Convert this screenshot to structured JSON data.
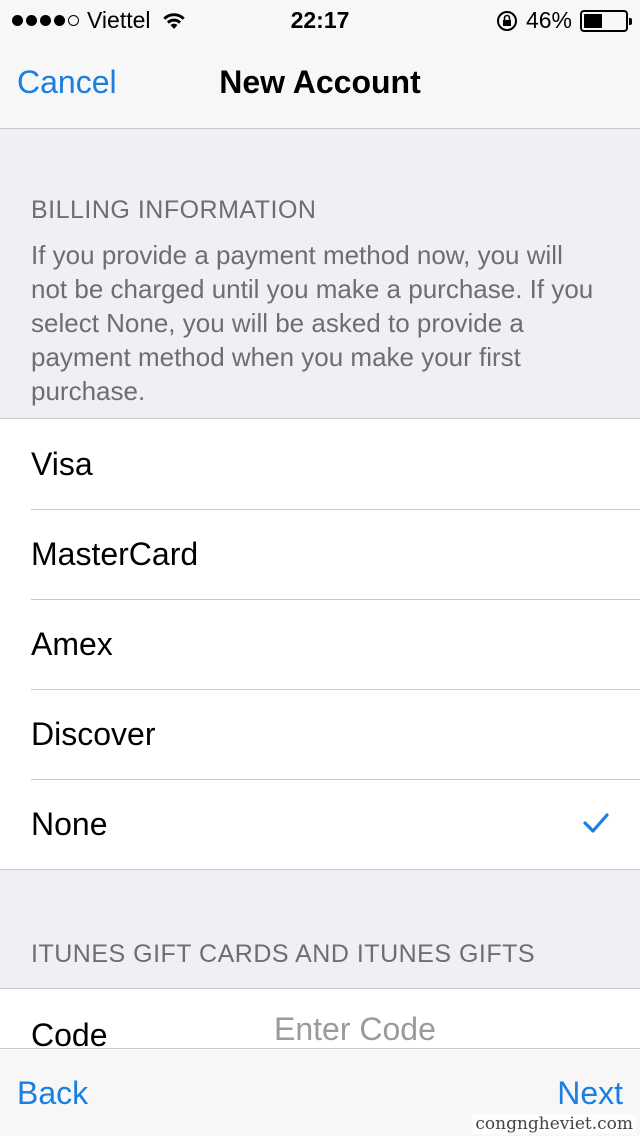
{
  "status_bar": {
    "carrier": "Viettel",
    "time": "22:17",
    "battery_percent_text": "46%",
    "battery_level": 0.46,
    "signal_icon": "signal-dots-icon",
    "wifi_icon": "wifi-icon",
    "rotation_lock_icon": "rotation-lock-icon"
  },
  "nav": {
    "cancel_label": "Cancel",
    "title": "New Account"
  },
  "billing": {
    "header": "BILLING INFORMATION",
    "footer": "If you provide a payment method now, you will not be charged until you make a purchase. If you select None, you will be asked to provide a payment method when you make your first purchase.",
    "options": [
      {
        "label": "Visa",
        "selected": false
      },
      {
        "label": "MasterCard",
        "selected": false
      },
      {
        "label": "Amex",
        "selected": false
      },
      {
        "label": "Discover",
        "selected": false
      },
      {
        "label": "None",
        "selected": true
      }
    ]
  },
  "gift": {
    "header": "ITUNES GIFT CARDS AND ITUNES GIFTS",
    "code_label": "Code",
    "code_placeholder": "Enter Code",
    "code_value": ""
  },
  "toolbar": {
    "back_label": "Back",
    "next_label": "Next"
  },
  "watermark": "congngheviet.com",
  "colors": {
    "accent": "#1a7fe0",
    "background": "#efeff4",
    "secondary_text": "#6d6d72"
  }
}
